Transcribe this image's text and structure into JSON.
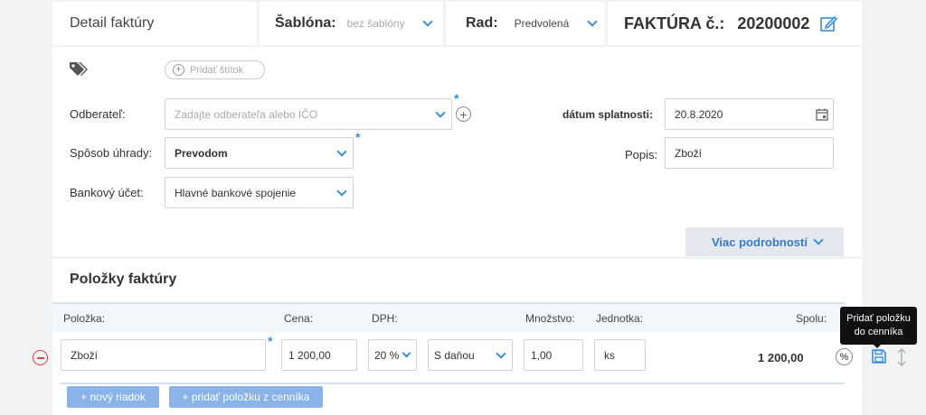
{
  "header": {
    "title": "Detail faktúry",
    "template_label": "Šablóna:",
    "template_value": "bez šablóny",
    "series_label": "Rad:",
    "series_value": "Predvolená",
    "invoice_label": "FAKTÚRA č.:",
    "invoice_number": "20200002"
  },
  "tags": {
    "add_tag_label": "Pridať štítok"
  },
  "form": {
    "customer_label": "Odberateľ:",
    "customer_placeholder": "Zadajte odberateľa alebo IČO",
    "payment_label": "Spôsob úhrady:",
    "payment_value": "Prevodom",
    "bank_label": "Bankový účet:",
    "bank_value": "Hlavné bankové spojenie",
    "due_label": "dátum splatnosti:",
    "due_value": "20.8.2020",
    "desc_label": "Popis:",
    "desc_value": "Zboží",
    "required_mark": "*",
    "more_details": "Viac podrobností"
  },
  "items": {
    "title": "Položky faktúry",
    "columns": {
      "item": "Položka:",
      "price": "Cena:",
      "vat": "DPH:",
      "qty": "Množstvo:",
      "unit": "Jednotka:",
      "total": "Spolu:"
    },
    "row": {
      "name": "Zboží",
      "price": "1 200,00",
      "vat": "20 %",
      "vat_mode": "S daňou",
      "qty": "1,00",
      "unit": "ks",
      "total": "1 200,00"
    },
    "new_row_label": "+ nový riadok",
    "add_from_catalog_label": "+ pridať položku z cenníka",
    "tooltip": "Pridať položku do cenníka"
  },
  "colors": {
    "accent": "#3a8ee0",
    "danger": "#e04848",
    "button": "#8ab4e8"
  }
}
